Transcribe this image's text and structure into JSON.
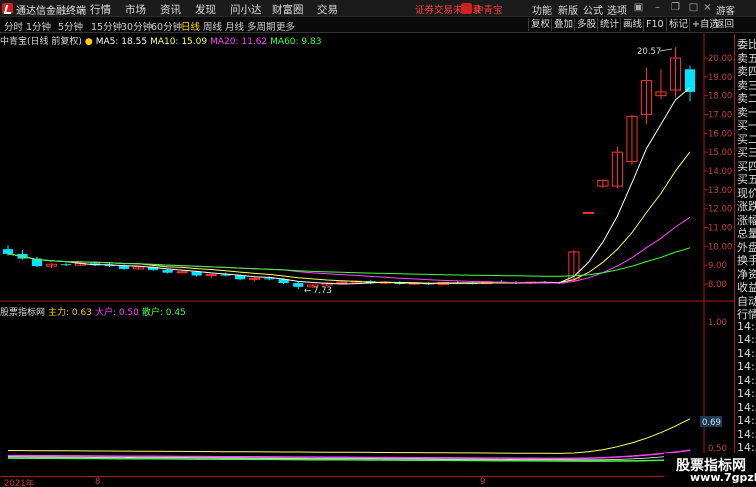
{
  "menubar": {
    "app_title": "通达信金融终端",
    "items": [
      "行情",
      "市场",
      "资讯",
      "发现",
      "问小达",
      "财富圈",
      "交易"
    ],
    "notice": "证券交易未登录",
    "brand": "中青宝",
    "right_items": [
      "功能",
      "新版",
      "公式",
      "选项"
    ],
    "user": "游客"
  },
  "toolbar": {
    "periods": [
      "分时",
      "1分钟",
      "5分钟",
      "15分钟",
      "30分钟",
      "60分钟",
      "日线",
      "周线",
      "月线",
      "多周期",
      "更多"
    ],
    "active_period": "日线",
    "buttons": [
      "复权",
      "叠加",
      "多股",
      "统计",
      "画线",
      "F10",
      "标记",
      "+自选",
      "返回"
    ]
  },
  "chart_info": {
    "title": "中青宝(日线 前复权)",
    "ma5": "MA5: 18.55",
    "ma10": "MA10: 15.09",
    "ma20": "MA20: 11.62",
    "ma60": "MA60: 9.83"
  },
  "indicator_info": {
    "title": "股票指标网",
    "main": "主力: 0.63",
    "big": "大户: 0.50",
    "retail": "散户: 0.45"
  },
  "annotations": {
    "high": "20.57",
    "low": "7.73",
    "current_indicator": "0.69"
  },
  "price_axis": [
    "20.00",
    "19.00",
    "18.00",
    "17.00",
    "16.00",
    "15.00",
    "14.00",
    "13.00",
    "12.00",
    "11.00",
    "10.00",
    "9.00",
    "8.00"
  ],
  "indicator_axis": [
    "1.00",
    "0.50"
  ],
  "side_panel": [
    "委比",
    "卖五",
    "卖四",
    "卖三",
    "卖二",
    "卖一",
    "买一",
    "买二",
    "买三",
    "买四",
    "买五",
    "现价",
    "涨跌",
    "涨幅",
    "总量",
    "外盘",
    "换手",
    "净资",
    "收益",
    "自动",
    "行情",
    "14:5",
    "14:5",
    "14:5",
    "14:5",
    "14:5",
    "14:5",
    "14:5",
    "14:5",
    "14:5",
    "14:5",
    "14:5"
  ],
  "dates": [
    "2021年",
    "8",
    "9"
  ],
  "watermark": {
    "line1": "股票指标网",
    "line2": "www.7gpzb.com"
  },
  "colors": {
    "up": "#ff3232",
    "down": "#00e4ff",
    "ma5": "#ffffff",
    "ma10": "#ffff66",
    "ma20": "#ff44ff",
    "ma60": "#44ff44"
  },
  "chart_data": {
    "type": "candlestick",
    "price_range": [
      7.5,
      20.6
    ],
    "candles_ohlc": [
      [
        9.85,
        10.05,
        9.5,
        9.6
      ],
      [
        9.6,
        9.8,
        9.3,
        9.35
      ],
      [
        9.35,
        9.45,
        8.9,
        8.95
      ],
      [
        8.95,
        9.1,
        8.85,
        9.05
      ],
      [
        9.05,
        9.1,
        8.95,
        9.0
      ],
      [
        9.0,
        9.2,
        8.95,
        9.1
      ],
      [
        9.1,
        9.15,
        8.95,
        9.0
      ],
      [
        9.0,
        9.1,
        8.9,
        8.95
      ],
      [
        8.95,
        9.05,
        8.75,
        8.8
      ],
      [
        8.8,
        8.95,
        8.75,
        8.9
      ],
      [
        8.9,
        8.95,
        8.7,
        8.75
      ],
      [
        8.75,
        8.8,
        8.55,
        8.6
      ],
      [
        8.6,
        8.7,
        8.55,
        8.65
      ],
      [
        8.65,
        8.7,
        8.4,
        8.45
      ],
      [
        8.45,
        8.55,
        8.3,
        8.5
      ],
      [
        8.5,
        8.6,
        8.4,
        8.45
      ],
      [
        8.45,
        8.5,
        8.2,
        8.25
      ],
      [
        8.25,
        8.35,
        8.15,
        8.3
      ],
      [
        8.3,
        8.4,
        8.2,
        8.25
      ],
      [
        8.25,
        8.3,
        8.0,
        8.05
      ],
      [
        8.05,
        8.15,
        7.73,
        7.85
      ],
      [
        7.85,
        8.0,
        7.8,
        7.95
      ],
      [
        7.95,
        8.1,
        7.9,
        8.05
      ],
      [
        8.05,
        8.15,
        8.0,
        8.1
      ],
      [
        8.1,
        8.2,
        8.05,
        8.15
      ],
      [
        8.15,
        8.2,
        8.0,
        8.05
      ],
      [
        8.05,
        8.15,
        8.0,
        8.1
      ],
      [
        8.1,
        8.15,
        7.95,
        8.0
      ],
      [
        8.0,
        8.1,
        7.95,
        8.05
      ],
      [
        8.05,
        8.1,
        7.95,
        7.98
      ],
      [
        7.98,
        8.1,
        7.95,
        8.08
      ],
      [
        8.08,
        8.15,
        8.02,
        8.05
      ],
      [
        8.05,
        8.1,
        7.98,
        8.02
      ],
      [
        8.02,
        8.15,
        8.0,
        8.12
      ],
      [
        8.12,
        8.2,
        8.05,
        8.1
      ],
      [
        8.1,
        8.15,
        8.0,
        8.05
      ],
      [
        8.05,
        8.12,
        8.0,
        8.1
      ],
      [
        8.1,
        8.15,
        8.02,
        8.08
      ],
      [
        8.08,
        8.12,
        8.0,
        8.05
      ],
      [
        8.2,
        9.8,
        8.15,
        9.7
      ],
      [
        11.8,
        11.8,
        11.8,
        11.8
      ],
      [
        13.2,
        13.55,
        13.1,
        13.5
      ],
      [
        13.2,
        15.3,
        13.1,
        15.0
      ],
      [
        14.5,
        17.0,
        14.3,
        16.9
      ],
      [
        17.0,
        19.5,
        16.5,
        18.8
      ],
      [
        18.0,
        19.4,
        17.8,
        18.2
      ],
      [
        18.3,
        20.57,
        17.9,
        20.0
      ],
      [
        19.4,
        19.6,
        17.7,
        18.2
      ]
    ],
    "ma_series": {
      "ma5_endpoints": [
        9.5,
        18.55
      ],
      "ma10_endpoints": [
        9.7,
        15.09
      ],
      "ma20_endpoints": [
        9.9,
        11.62
      ],
      "ma60_endpoints": [
        9.3,
        9.83
      ]
    }
  }
}
